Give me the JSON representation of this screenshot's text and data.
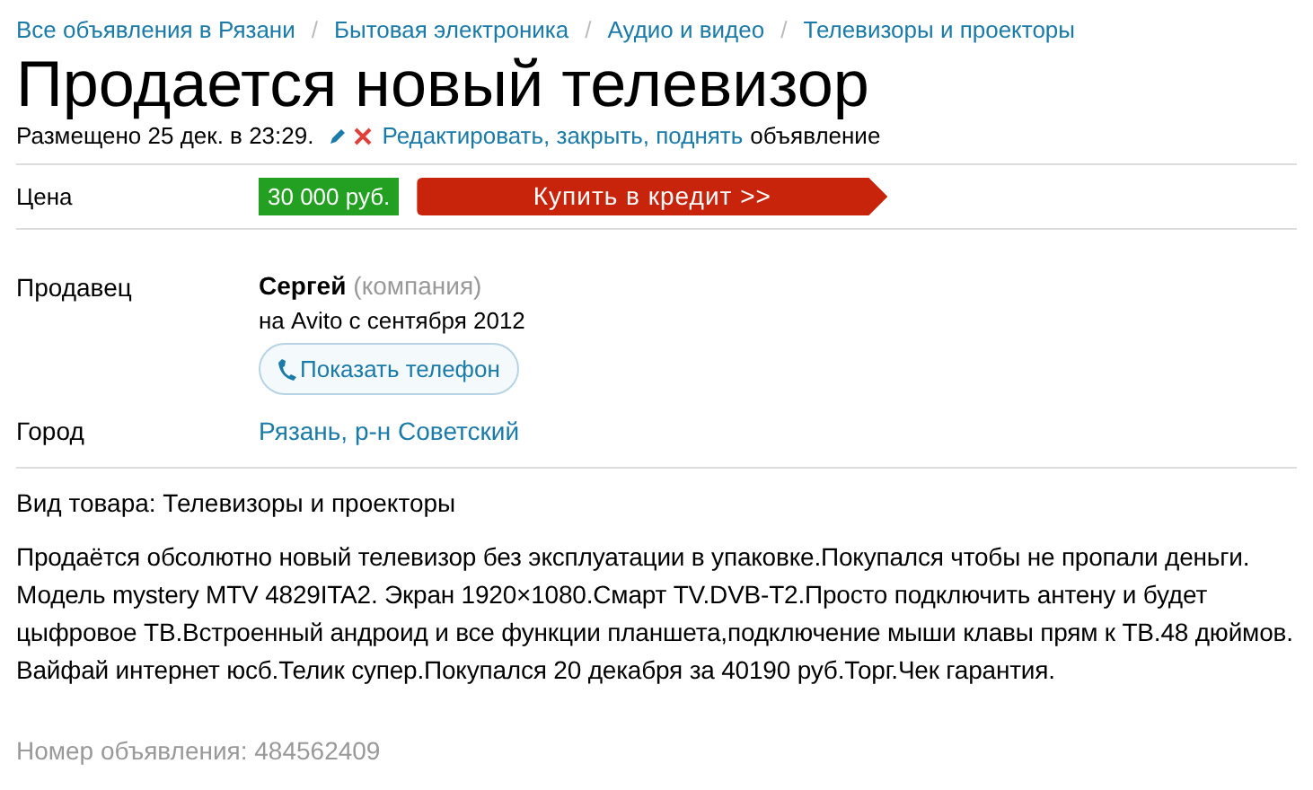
{
  "breadcrumb_separator": "/",
  "breadcrumbs": [
    "Все объявления в Рязани",
    "Бытовая электроника",
    "Аудио и видео",
    "Телевизоры и проекторы"
  ],
  "title": "Продается новый телевизор",
  "meta": {
    "posted": "Размещено 25 дек. в 23:29.",
    "edit_link": "Редактировать, закрыть, поднять",
    "suffix": "объявление"
  },
  "price": {
    "label": "Цена",
    "value": "30 000 руб.",
    "credit_button": "Купить в кредит >>"
  },
  "seller": {
    "label": "Продавец",
    "name": "Сергей",
    "type": "(компания)",
    "since": "на Avito с сентября 2012",
    "phone_button": "Показать телефон"
  },
  "city": {
    "label": "Город",
    "value": "Рязань, р-н Советский"
  },
  "category": "Вид товара: Телевизоры и проекторы",
  "description": [
    "Продаётся обсолютно новый телевизор без эксплуатации в упаковке.Покупался чтобы не пропали деньги.",
    "Модель mystery MTV 4829ITA2. Экран 1920×1080.Смарт TV.DVB-T2.Просто подключить антену и будет",
    "цыфровое ТВ.Встроенный андроид и все функции планшета,подключение мыши клавы прям к ТВ.48 дюймов.",
    "Вайфай интернет юсб.Телик супер.Покупался 20 декабря за 40190 руб.Торг.Чек гарантия."
  ],
  "ad_number": "Номер объявления: 484562409"
}
